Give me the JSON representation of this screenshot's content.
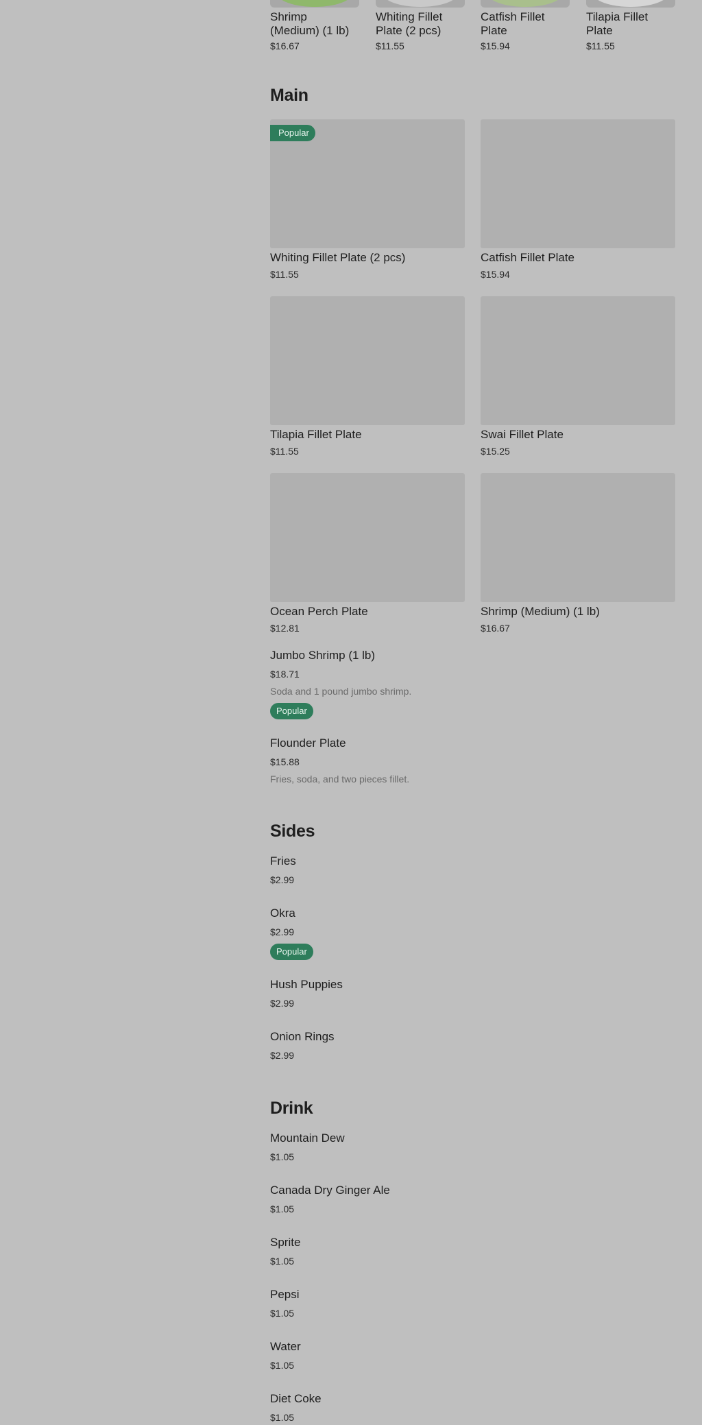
{
  "featured": [
    {
      "name": "Shrimp (Medium) (1 lb)",
      "price": "$16.67",
      "plate_color": "#8fb86b"
    },
    {
      "name": "Whiting Fillet Plate (2 pcs)",
      "price": "$11.55",
      "plate_color": "#c9c9c9"
    },
    {
      "name": "Catfish Fillet Plate",
      "price": "$15.94",
      "plate_color": "#a9bf8c"
    },
    {
      "name": "Tilapia Fillet Plate",
      "price": "$11.55",
      "plate_color": "#d6d6d6"
    }
  ],
  "main": {
    "title": "Main",
    "grid": [
      {
        "name": "Whiting Fillet Plate (2 pcs)",
        "price": "$11.55",
        "badge": "Popular"
      },
      {
        "name": "Catfish Fillet Plate",
        "price": "$15.94"
      },
      {
        "name": "Tilapia Fillet Plate",
        "price": "$11.55"
      },
      {
        "name": "Swai Fillet Plate",
        "price": "$15.25"
      },
      {
        "name": "Ocean Perch Plate",
        "price": "$12.81"
      },
      {
        "name": "Shrimp (Medium) (1 lb)",
        "price": "$16.67"
      }
    ],
    "list": [
      {
        "name": "Jumbo Shrimp (1 lb)",
        "price": "$18.71",
        "desc": "Soda and 1 pound jumbo shrimp.",
        "badge": "Popular"
      },
      {
        "name": "Flounder Plate",
        "price": "$15.88",
        "desc": "Fries, soda, and two pieces fillet."
      }
    ]
  },
  "sides": {
    "title": "Sides",
    "items": [
      {
        "name": "Fries",
        "price": "$2.99"
      },
      {
        "name": "Okra",
        "price": "$2.99",
        "badge": "Popular"
      },
      {
        "name": "Hush Puppies",
        "price": "$2.99"
      },
      {
        "name": "Onion Rings",
        "price": "$2.99"
      }
    ]
  },
  "drink": {
    "title": "Drink",
    "items": [
      {
        "name": "Mountain Dew",
        "price": "$1.05"
      },
      {
        "name": "Canada Dry Ginger Ale",
        "price": "$1.05"
      },
      {
        "name": "Sprite",
        "price": "$1.05"
      },
      {
        "name": "Pepsi",
        "price": "$1.05"
      },
      {
        "name": "Water",
        "price": "$1.05"
      },
      {
        "name": "Diet Coke",
        "price": "$1.05"
      }
    ]
  }
}
